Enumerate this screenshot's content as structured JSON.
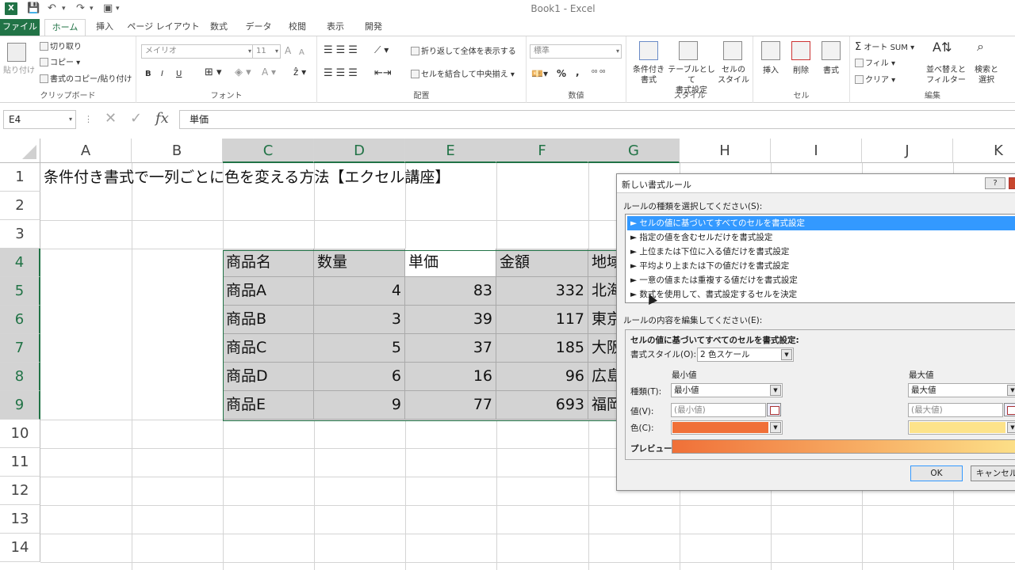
{
  "window": {
    "title": "Book1 - Excel",
    "logo": "X"
  },
  "quick_access": {
    "save_icon": "save-icon",
    "undo_icon": "undo-icon",
    "redo_icon": "redo-icon",
    "camera_icon": "camera-icon"
  },
  "tabs": [
    "ファイル",
    "ホーム",
    "挿入",
    "ページ レイアウト",
    "数式",
    "データ",
    "校閲",
    "表示",
    "開発"
  ],
  "active_tab": "ホーム",
  "ribbon": {
    "clipboard": {
      "paste": "貼り付け",
      "cut": "切り取り",
      "copy": "コピー",
      "format_painter": "書式のコピー/貼り付け",
      "label": "クリップボード"
    },
    "font": {
      "font_name": "メイリオ",
      "font_size": "11",
      "grow": "A",
      "shrink": "A",
      "bold": "B",
      "italic": "I",
      "underline": "U",
      "label": "フォント"
    },
    "alignment": {
      "wrap": "折り返して全体を表示する",
      "merge": "セルを結合して中央揃え",
      "label": "配置"
    },
    "number": {
      "format": "標準",
      "percent": "%",
      "comma": ",",
      "label": "数値"
    },
    "styles": {
      "conditional": "条件付き\n書式",
      "table": "テーブルとして\n書式設定",
      "cell": "セルの\nスタイル",
      "label": "スタイル"
    },
    "cells": {
      "insert": "挿入",
      "delete": "削除",
      "format": "書式",
      "label": "セル"
    },
    "editing": {
      "autosum": "オート SUM",
      "fill": "フィル",
      "clear": "クリア",
      "sort": "並べ替えと\nフィルター",
      "find": "検索と\n選択",
      "label": "編集"
    }
  },
  "formula_bar": {
    "name_box": "E4",
    "cancel": "✕",
    "enter": "✓",
    "fx": "fx",
    "value": "単価"
  },
  "columns": [
    "A",
    "B",
    "C",
    "D",
    "E",
    "F",
    "G",
    "H",
    "I",
    "J",
    "K"
  ],
  "rows": [
    "1",
    "2",
    "3",
    "4",
    "5",
    "6",
    "7",
    "8",
    "9",
    "10",
    "11",
    "12",
    "13",
    "14"
  ],
  "sheet": {
    "title": "条件付き書式で一列ごとに色を変える方法【エクセル講座】",
    "headers": [
      "商品名",
      "数量",
      "単価",
      "金額",
      "地域"
    ],
    "data": [
      [
        "商品A",
        "4",
        "83",
        "332",
        "北海道"
      ],
      [
        "商品B",
        "3",
        "39",
        "117",
        "東京"
      ],
      [
        "商品C",
        "5",
        "37",
        "185",
        "大阪"
      ],
      [
        "商品D",
        "6",
        "16",
        "96",
        "広島"
      ],
      [
        "商品E",
        "9",
        "77",
        "693",
        "福岡"
      ]
    ]
  },
  "dialog": {
    "title": "新しい書式ルール",
    "help": "?",
    "close": "✕",
    "rule_type_label": "ルールの種類を選択してください(S):",
    "rules": [
      "► セルの値に基づいてすべてのセルを書式設定",
      "► 指定の値を含むセルだけを書式設定",
      "► 上位または下位に入る値だけを書式設定",
      "► 平均より上または下の値だけを書式設定",
      "► 一意の値または重複する値だけを書式設定",
      "► 数式を使用して、書式設定するセルを決定"
    ],
    "edit_label": "ルールの内容を編集してください(E):",
    "edit_heading": "セルの値に基づいてすべてのセルを書式設定:",
    "style_label": "書式スタイル(O):",
    "style_value": "2 色スケール",
    "min_label": "最小値",
    "max_label": "最大値",
    "type_label": "種類(T):",
    "min_type": "最小値",
    "max_type": "最大値",
    "value_label": "値(V):",
    "min_value_placeholder": "(最小値)",
    "max_value_placeholder": "(最大値)",
    "color_label": "色(C):",
    "min_color": "#f07038",
    "max_color": "#fde38a",
    "preview_label": "プレビュー:",
    "ok": "OK",
    "cancel": "キャンセル"
  }
}
